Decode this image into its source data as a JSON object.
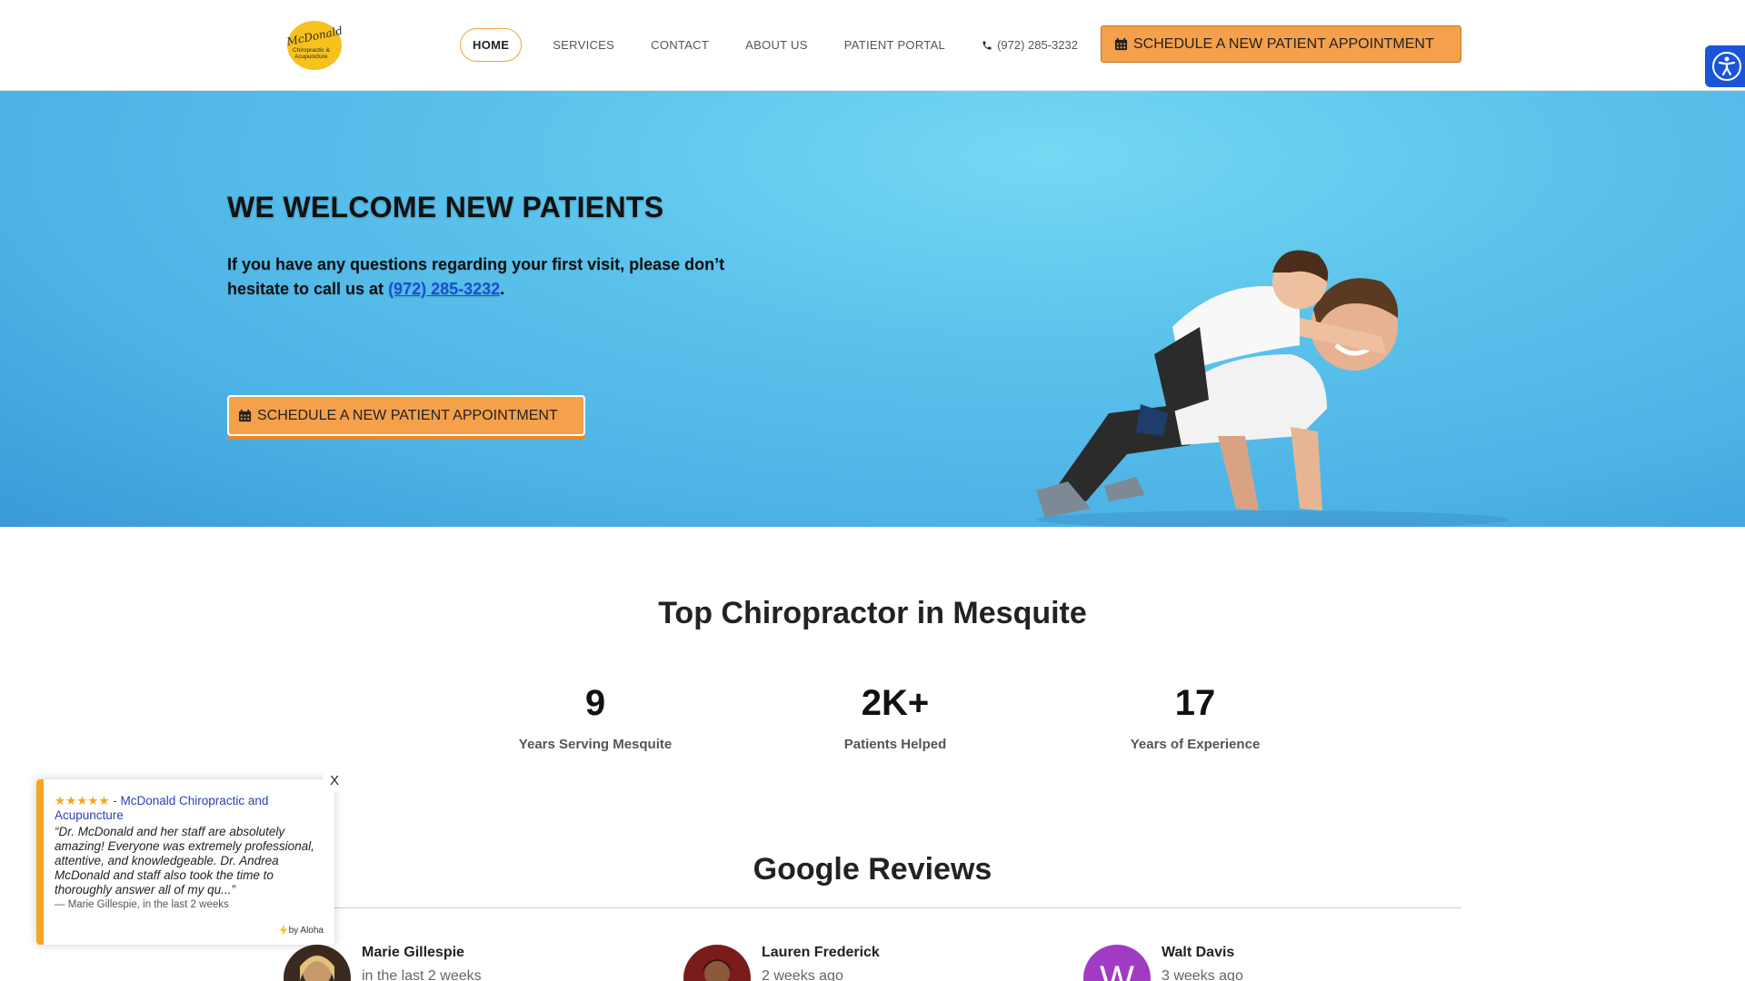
{
  "header": {
    "logo_text": "McDonald",
    "logo_sub": "Chiropractic & Acupuncture",
    "nav": [
      {
        "label": "HOME"
      },
      {
        "label": "SERVICES"
      },
      {
        "label": "CONTACT"
      },
      {
        "label": "ABOUT US"
      },
      {
        "label": "PATIENT PORTAL"
      }
    ],
    "phone": "(972) 285-3232",
    "cta_label": "SCHEDULE A NEW PATIENT APPOINTMENT"
  },
  "hero": {
    "title": "WE WELCOME NEW PATIENTS",
    "text_before": "If you have any questions regarding your first visit, please don’t hesitate to call us at ",
    "phone_link": "(972) 285-3232",
    "text_after": ".",
    "cta_label": "SCHEDULE A NEW PATIENT APPOINTMENT"
  },
  "stats_section": {
    "title": "Top Chiropractor in Mesquite",
    "stats": [
      {
        "value": "9",
        "label": "Years Serving Mesquite"
      },
      {
        "value": "2K+",
        "label": "Patients Helped"
      },
      {
        "value": "17",
        "label": "Years of Experience"
      }
    ]
  },
  "reviews_section": {
    "title": "Google Reviews",
    "reviewers": [
      {
        "name": "Marie Gillespie",
        "time": "in the last 2 weeks",
        "initial": ""
      },
      {
        "name": "Lauren Frederick",
        "time": "2 weeks ago",
        "initial": ""
      },
      {
        "name": "Walt Davis",
        "time": "3 weeks ago",
        "initial": "W"
      }
    ]
  },
  "popup": {
    "close_label": "X",
    "stars": "★★★★★",
    "separator": " - ",
    "business": "McDonald Chiropractic and Acupuncture",
    "quote": "“Dr. McDonald and her staff are absolutely amazing! Everyone was extremely professional, attentive, and knowledgeable. Dr. Andrea McDonald and staff also took the time to thoroughly answer all of my qu...”",
    "author": "— Marie Gillespie, in the last 2 weeks",
    "by": "by Aloha"
  },
  "colors": {
    "accent": "#f5a04a",
    "hero_blue": "#5cc3ec",
    "link": "#1a4fd6",
    "a11y": "#1a55d6",
    "star": "#f5a623",
    "avatar_w": "#a23bc4"
  },
  "icons": [
    "phone-icon",
    "calendar-icon",
    "accessibility-icon",
    "bolt-icon"
  ]
}
